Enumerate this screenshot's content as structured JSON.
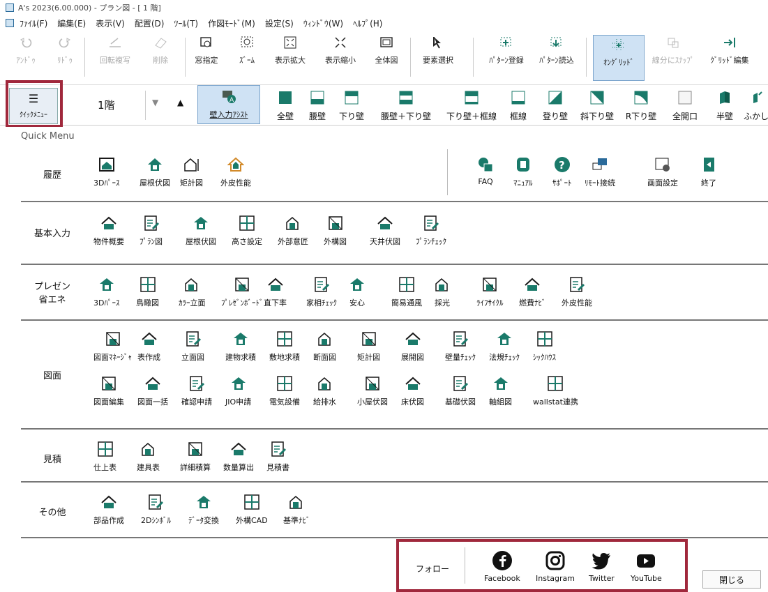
{
  "window": {
    "title": "A's 2023(6.00.000) - プラン図 - [ 1 階]"
  },
  "menu": [
    "ﾌｧｲﾙ(F)",
    "編集(E)",
    "表示(V)",
    "配置(D)",
    "ﾂｰﾙ(T)",
    "作図ﾓｰﾄﾞ(M)",
    "設定(S)",
    "ｳｨﾝﾄﾞｳ(W)",
    "ﾍﾙﾌﾟ(H)"
  ],
  "toolbar1": {
    "undo": "ｱﾝﾄﾞｩ",
    "redo": "ﾘﾄﾞｩ",
    "rotate_copy": "回転複写",
    "delete": "削除",
    "window_select": "窓指定",
    "zoom": "ｽﾞｰﾑ",
    "zoom_in": "表示拡大",
    "zoom_out": "表示縮小",
    "full_view": "全体図",
    "element_select": "要素選択",
    "pattern_register": "ﾊﾟﾀｰﾝ登録",
    "pattern_load": "ﾊﾟﾀｰﾝ読込",
    "on_grid": "ｵﾝｸﾞﾘｯﾄﾞ",
    "snap_segment": "線分にｽﾅｯﾌﾟ",
    "grid_edit": "ｸﾞﾘｯﾄﾞ編集"
  },
  "toolbar2": {
    "quick_menu": "ｸｲｯｸﾒﾆｭｰ",
    "floor": "1階",
    "assist": "壁入力ｱｼｽﾄ",
    "walls": [
      "全壁",
      "腰壁",
      "下り壁",
      "腰壁＋下り壁",
      "下り壁＋框線",
      "框線",
      "登り壁",
      "斜下り壁",
      "R下り壁",
      "全開口",
      "半壁",
      "ふかし"
    ]
  },
  "quick_menu": {
    "title": "Quick Menu",
    "history": {
      "caption": "履歴",
      "items": [
        "3Dﾊﾟｰｽ",
        "屋根伏図",
        "矩計図",
        "外皮性能"
      ]
    },
    "support": [
      "FAQ",
      "ﾏﾆｭｱﾙ",
      "ｻﾎﾟｰﾄ",
      "ﾘﾓｰﾄ接続",
      "画面設定",
      "終了"
    ],
    "basic": {
      "caption": "基本入力",
      "items": [
        "物件概要",
        "ﾌﾟﾗﾝ図",
        "屋根伏図",
        "高さ設定",
        "外部意匠",
        "外構図",
        "天井伏図",
        "ﾌﾟﾗﾝﾁｪｯｸ"
      ]
    },
    "present": {
      "caption1": "プレゼン",
      "caption2": "省エネ",
      "items": [
        "3Dﾊﾟｰｽ",
        "鳥瞰図",
        "ｶﾗｰ立面",
        "ﾌﾟﾚｾﾞﾝﾎﾞｰﾄﾞ",
        "直下率",
        "家相ﾁｪｯｸ",
        "安心",
        "簡易通風",
        "採光",
        "ﾗｲﾌｻｲｸﾙ",
        "燃費ﾅﾋﾞ",
        "外皮性能"
      ]
    },
    "drawing": {
      "caption": "図面",
      "row1": [
        "図面ﾏﾈｰｼﾞｬ",
        "表作成",
        "立面図",
        "建物求積",
        "敷地求積",
        "断面図",
        "矩計図",
        "展開図",
        "壁量ﾁｪｯｸ",
        "法規ﾁｪｯｸ",
        "ｼｯｸﾊｳｽ"
      ],
      "row2": [
        "図面編集",
        "図面一括",
        "確認申請",
        "JIO申請",
        "電気設備",
        "給排水",
        "小屋伏図",
        "床伏図",
        "基礎伏図",
        "軸組図",
        "wallstat連携"
      ]
    },
    "estimate": {
      "caption": "見積",
      "items": [
        "仕上表",
        "建具表",
        "詳細積算",
        "数量算出",
        "見積書"
      ]
    },
    "other": {
      "caption": "その他",
      "items": [
        "部品作成",
        "2Dｼﾝﾎﾞﾙ",
        "ﾃﾞｰﾀ変換",
        "外構CAD",
        "基準ﾅﾋﾞ"
      ]
    },
    "follow": {
      "label": "フォロー",
      "items": [
        "Facebook",
        "Instagram",
        "Twitter",
        "YouTube"
      ]
    },
    "close": "閉じる"
  },
  "colors": {
    "accent": "#1a7a6a",
    "highlight": "#a0283c",
    "icon": "#1a1a1a"
  }
}
